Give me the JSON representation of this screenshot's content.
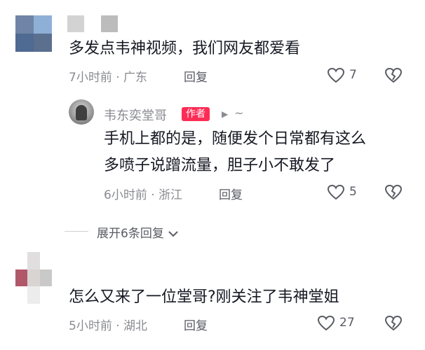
{
  "comments": [
    {
      "text": "多发点韦神视频，我们网友都爱看",
      "time": "7小时前",
      "location": "广东",
      "reply_label": "回复",
      "likes": "7"
    },
    {
      "text": "怎么又来了一位堂哥?刚关注了韦神堂姐",
      "time": "5小时前",
      "location": "湖北",
      "reply_label": "回复",
      "likes": "27"
    }
  ],
  "reply": {
    "author": "韦东奕堂哥",
    "badge": "作者",
    "arrow": "▶",
    "tilde": "~",
    "line1": "手机上都的是，随便发个日常都有这么",
    "line2": "多喷子说蹭流量，胆子小不敢发了",
    "time": "6小时前",
    "location": "浙江",
    "reply_label": "回复",
    "likes": "5"
  },
  "expand_label": "展开6条回复",
  "separator": "·",
  "icons": {
    "like": "heart-outline-icon",
    "dislike": "broken-heart-icon",
    "expand": "chevron-down-icon"
  }
}
